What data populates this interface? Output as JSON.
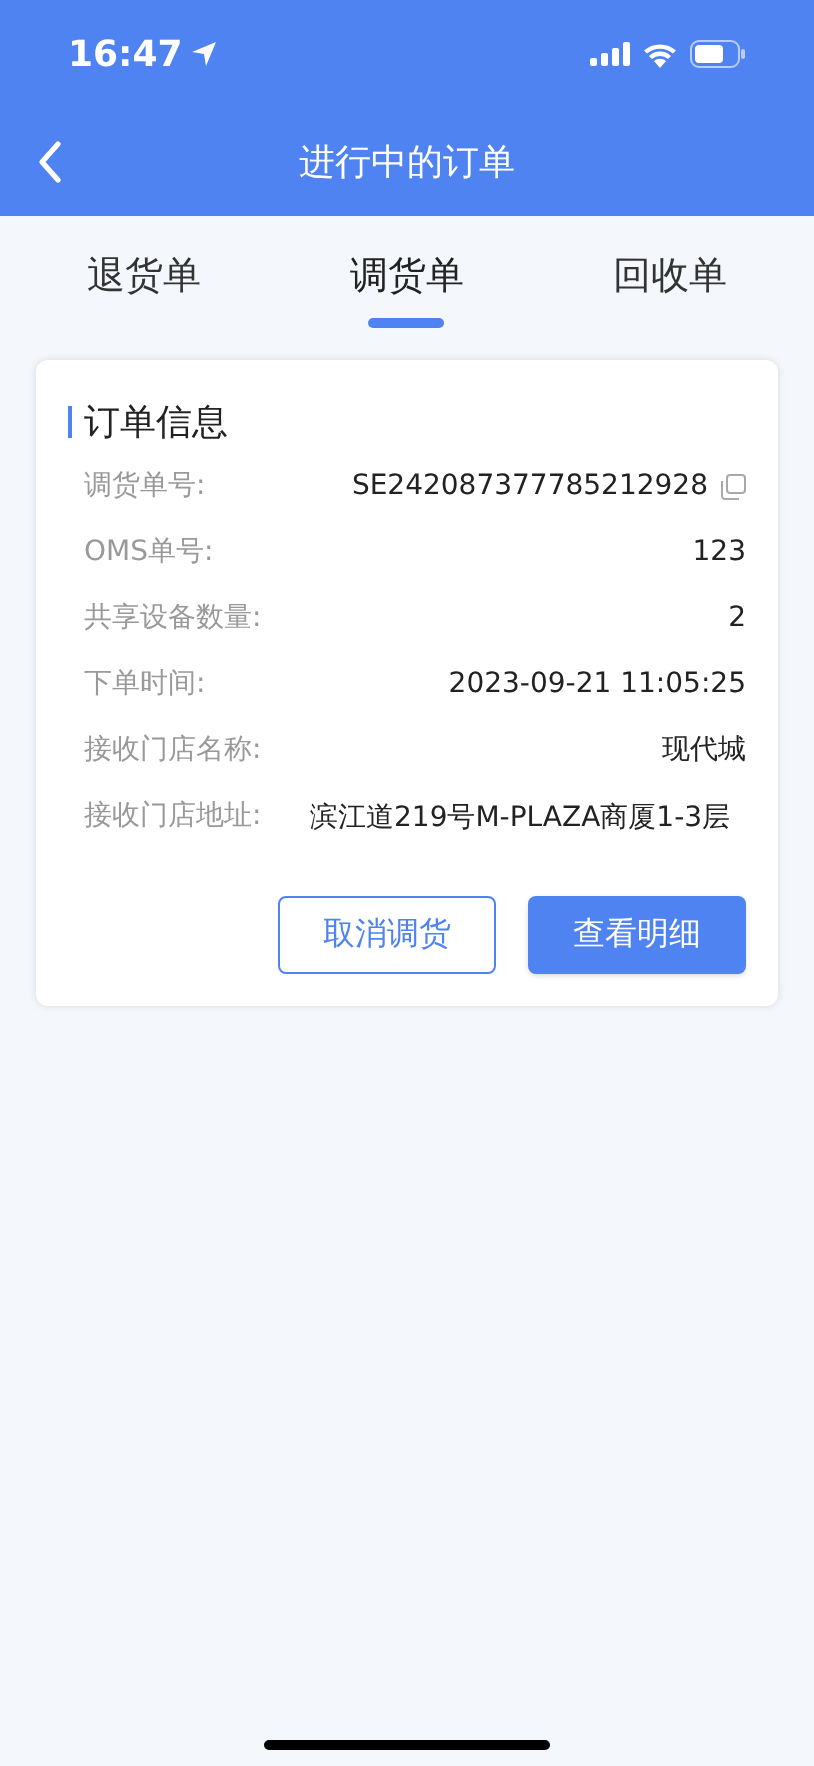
{
  "status_bar": {
    "time": "16:47"
  },
  "nav": {
    "title": "进行中的订单"
  },
  "tabs": [
    {
      "label": "退货单",
      "selected": false
    },
    {
      "label": "调货单",
      "selected": true
    },
    {
      "label": "回收单",
      "selected": false
    }
  ],
  "card": {
    "title": "订单信息",
    "rows": [
      {
        "kind": "copyable",
        "label": "调货单号:",
        "value": "SE242087377785212928"
      },
      {
        "kind": "plain",
        "label": "OMS单号:",
        "value": "123"
      },
      {
        "kind": "plain",
        "label": "共享设备数量:",
        "value": "2"
      },
      {
        "kind": "plain",
        "label": "下单时间:",
        "value": "2023-09-21 11:05:25"
      },
      {
        "kind": "plain",
        "label": "接收门店名称:",
        "value": "现代城"
      },
      {
        "kind": "multiline",
        "label": "接收门店地址:",
        "value": "滨江道219号M-PLAZA商厦1-3层"
      }
    ],
    "buttons": [
      {
        "kind": "outline",
        "label": "取消调货"
      },
      {
        "kind": "primary",
        "label": "查看明细"
      }
    ]
  }
}
